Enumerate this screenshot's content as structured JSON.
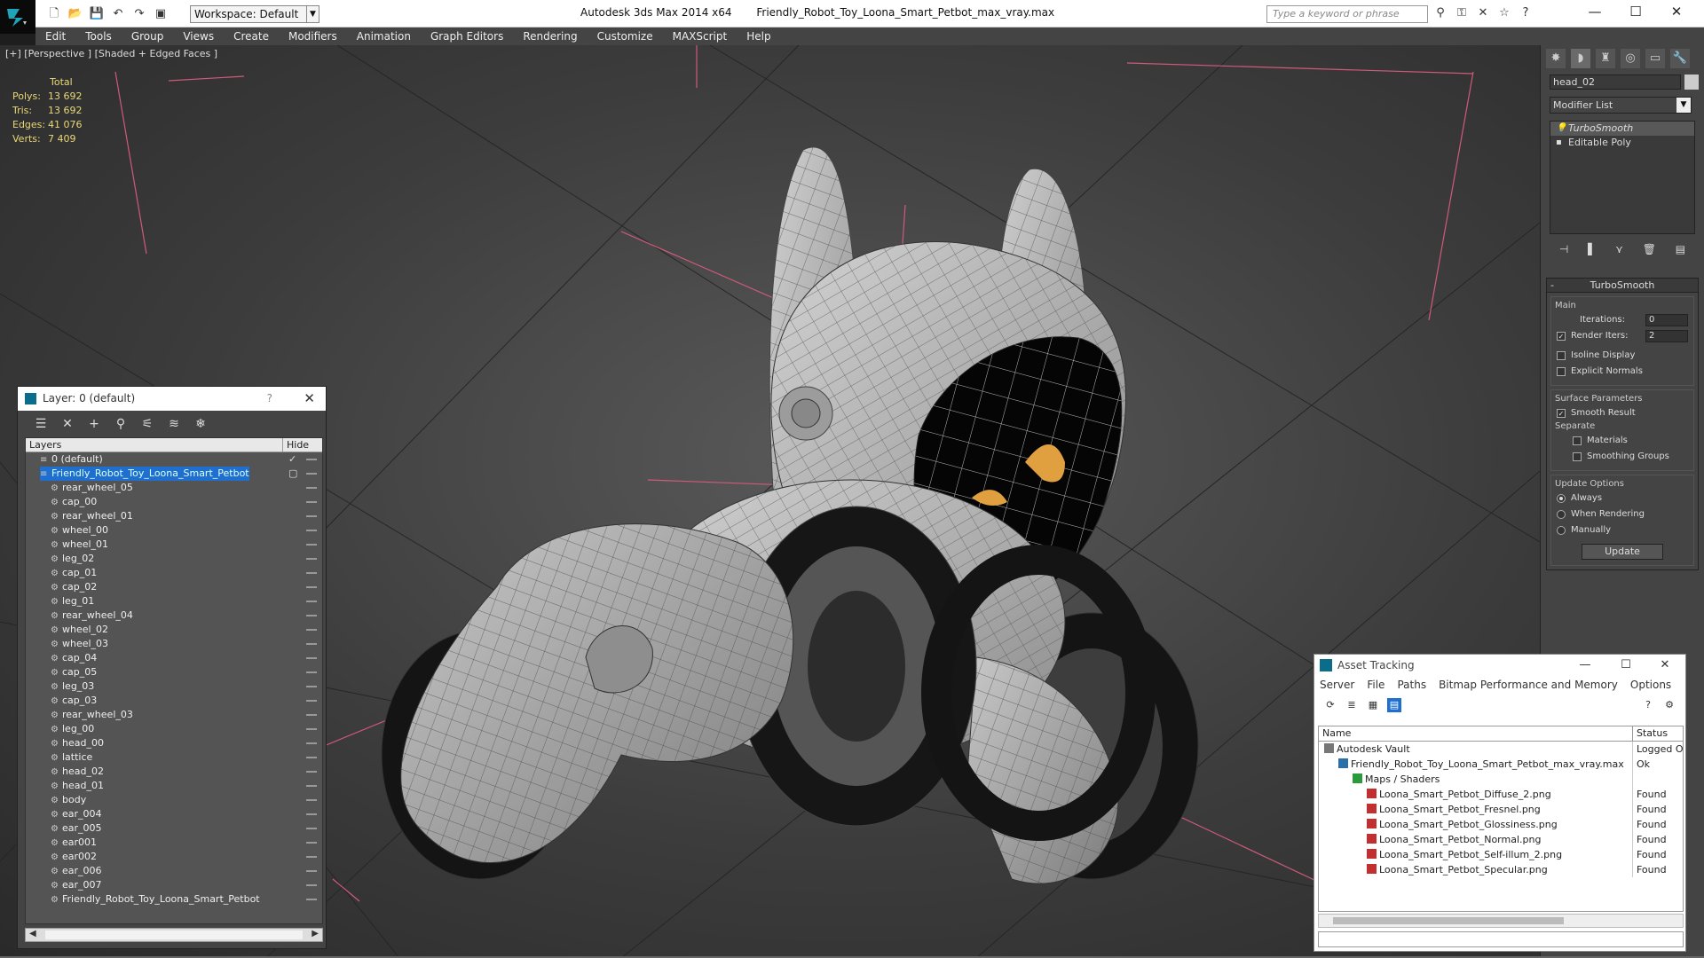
{
  "titlebar": {
    "app_name": "Autodesk 3ds Max  2014 x64",
    "file_name": "Friendly_Robot_Toy_Loona_Smart_Petbot_max_vray.max",
    "workspace_label": "Workspace: Default",
    "search_placeholder": "Type a keyword or phrase",
    "minimize": "—",
    "maximize": "☐",
    "close": "✕"
  },
  "menu": [
    "Edit",
    "Tools",
    "Group",
    "Views",
    "Create",
    "Modifiers",
    "Animation",
    "Graph Editors",
    "Rendering",
    "Customize",
    "MAXScript",
    "Help"
  ],
  "viewport": {
    "label": "[+] [Perspective ] [Shaded + Edged Faces ]",
    "stats": {
      "header": "Total",
      "rows": [
        {
          "k": "Polys:",
          "v": "13 692"
        },
        {
          "k": "Tris:",
          "v": "13 692"
        },
        {
          "k": "Edges:",
          "v": "41 076"
        },
        {
          "k": "Verts:",
          "v": "7 409"
        }
      ]
    }
  },
  "layer_window": {
    "title": "Layer: 0 (default)",
    "help": "?",
    "close": "✕",
    "col_layers": "Layers",
    "col_hide": "Hide",
    "rows": [
      {
        "name": "0 (default)",
        "level": 1,
        "type": "layer",
        "check": "✓"
      },
      {
        "name": "Friendly_Robot_Toy_Loona_Smart_Petbot",
        "level": 1,
        "type": "layer",
        "selected": true,
        "check": "▢"
      },
      {
        "name": "rear_wheel_05",
        "level": 2,
        "type": "obj"
      },
      {
        "name": "cap_00",
        "level": 2,
        "type": "obj"
      },
      {
        "name": "rear_wheel_01",
        "level": 2,
        "type": "obj"
      },
      {
        "name": "wheel_00",
        "level": 2,
        "type": "obj"
      },
      {
        "name": "wheel_01",
        "level": 2,
        "type": "obj"
      },
      {
        "name": "leg_02",
        "level": 2,
        "type": "obj"
      },
      {
        "name": "cap_01",
        "level": 2,
        "type": "obj"
      },
      {
        "name": "cap_02",
        "level": 2,
        "type": "obj"
      },
      {
        "name": "leg_01",
        "level": 2,
        "type": "obj"
      },
      {
        "name": "rear_wheel_04",
        "level": 2,
        "type": "obj"
      },
      {
        "name": "wheel_02",
        "level": 2,
        "type": "obj"
      },
      {
        "name": "wheel_03",
        "level": 2,
        "type": "obj"
      },
      {
        "name": "cap_04",
        "level": 2,
        "type": "obj"
      },
      {
        "name": "cap_05",
        "level": 2,
        "type": "obj"
      },
      {
        "name": "leg_03",
        "level": 2,
        "type": "obj"
      },
      {
        "name": "cap_03",
        "level": 2,
        "type": "obj"
      },
      {
        "name": "rear_wheel_03",
        "level": 2,
        "type": "obj"
      },
      {
        "name": "leg_00",
        "level": 2,
        "type": "obj"
      },
      {
        "name": "head_00",
        "level": 2,
        "type": "obj"
      },
      {
        "name": "lattice",
        "level": 2,
        "type": "obj"
      },
      {
        "name": "head_02",
        "level": 2,
        "type": "obj"
      },
      {
        "name": "head_01",
        "level": 2,
        "type": "obj"
      },
      {
        "name": "body",
        "level": 2,
        "type": "obj"
      },
      {
        "name": "ear_004",
        "level": 2,
        "type": "obj"
      },
      {
        "name": "ear_005",
        "level": 2,
        "type": "obj"
      },
      {
        "name": "ear001",
        "level": 2,
        "type": "obj"
      },
      {
        "name": "ear002",
        "level": 2,
        "type": "obj"
      },
      {
        "name": "ear_006",
        "level": 2,
        "type": "obj"
      },
      {
        "name": "ear_007",
        "level": 2,
        "type": "obj"
      },
      {
        "name": "Friendly_Robot_Toy_Loona_Smart_Petbot",
        "level": 2,
        "type": "obj"
      }
    ]
  },
  "command_panel": {
    "object_name": "head_02",
    "modifier_list": "Modifier List",
    "stack": [
      {
        "name": "TurboSmooth",
        "modifier": true
      },
      {
        "name": "Editable Poly",
        "modifier": false
      }
    ],
    "rollout_title": "TurboSmooth",
    "main_label": "Main",
    "iterations_label": "Iterations:",
    "iterations_value": "0",
    "render_iters_label": "Render Iters:",
    "render_iters_value": "2",
    "isoline_label": "Isoline Display",
    "explicit_normals_label": "Explicit Normals",
    "surface_params_label": "Surface Parameters",
    "smooth_result_label": "Smooth Result",
    "separate_label": "Separate",
    "materials_label": "Materials",
    "smoothing_groups_label": "Smoothing Groups",
    "update_options_label": "Update Options",
    "always_label": "Always",
    "when_rendering_label": "When Rendering",
    "manually_label": "Manually",
    "update_button": "Update",
    "check_mark": "✓"
  },
  "asset_tracking": {
    "title": "Asset Tracking",
    "menu": [
      "Server",
      "File",
      "Paths",
      "Bitmap Performance and Memory",
      "Options"
    ],
    "col_name": "Name",
    "col_status": "Status",
    "rows": [
      {
        "name": "Autodesk Vault",
        "status": "Logged O",
        "indent": 0,
        "icon": "vault"
      },
      {
        "name": "Friendly_Robot_Toy_Loona_Smart_Petbot_max_vray.max",
        "status": "Ok",
        "indent": 1,
        "icon": "max"
      },
      {
        "name": "Maps / Shaders",
        "status": "",
        "indent": 2,
        "icon": "maps"
      },
      {
        "name": "Loona_Smart_Petbot_Diffuse_2.png",
        "status": "Found",
        "indent": 3,
        "icon": "png"
      },
      {
        "name": "Loona_Smart_Petbot_Fresnel.png",
        "status": "Found",
        "indent": 3,
        "icon": "png"
      },
      {
        "name": "Loona_Smart_Petbot_Glossiness.png",
        "status": "Found",
        "indent": 3,
        "icon": "png"
      },
      {
        "name": "Loona_Smart_Petbot_Normal.png",
        "status": "Found",
        "indent": 3,
        "icon": "png"
      },
      {
        "name": "Loona_Smart_Petbot_Self-illum_2.png",
        "status": "Found",
        "indent": 3,
        "icon": "png"
      },
      {
        "name": "Loona_Smart_Petbot_Specular.png",
        "status": "Found",
        "indent": 3,
        "icon": "png"
      }
    ]
  },
  "colors": {
    "selection_blue": "#1e6fd0",
    "stats_yellow": "#e8d878",
    "ui_dark": "#444444"
  }
}
